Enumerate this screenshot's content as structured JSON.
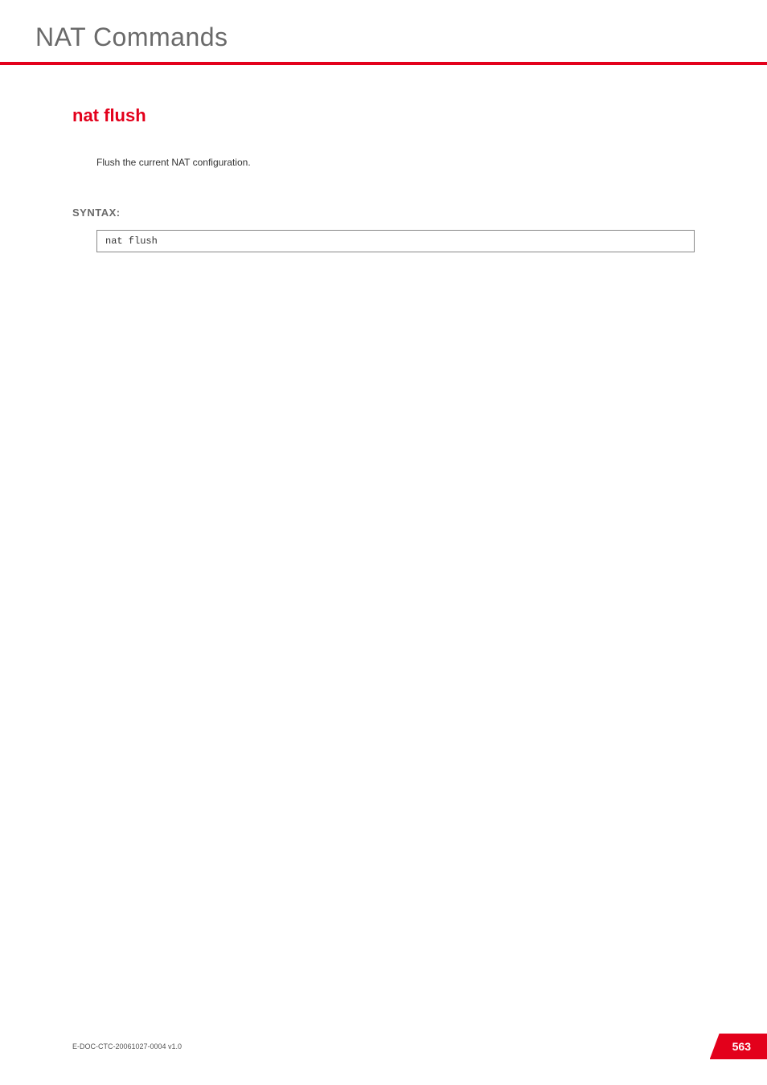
{
  "chapter": {
    "title": "NAT Commands"
  },
  "section": {
    "title": "nat flush",
    "description": "Flush the current NAT configuration."
  },
  "syntax": {
    "label": "SYNTAX:",
    "command": "nat flush"
  },
  "footer": {
    "doc_reference": "E-DOC-CTC-20061027-0004 v1.0",
    "page_number": "563"
  }
}
